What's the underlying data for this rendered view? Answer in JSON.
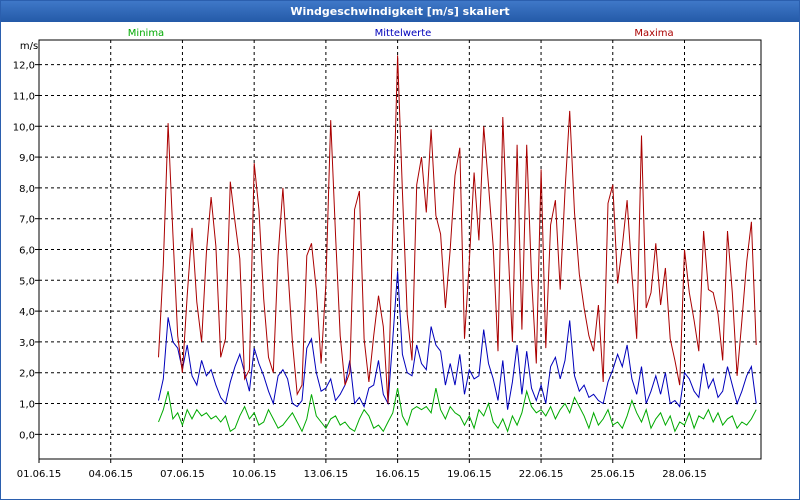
{
  "window": {
    "title": "Windgeschwindigkeit [m/s] skaliert"
  },
  "colors": {
    "minima": "#00aa00",
    "mittelwerte": "#0000bb",
    "maxima": "#aa0000",
    "grid": "#000000"
  },
  "chart_data": {
    "type": "line",
    "ylabel": "m/s",
    "ylim": [
      -0.8,
      12.8
    ],
    "xlim": [
      0,
      30.2
    ],
    "x_ticks": [
      0,
      3,
      6,
      9,
      12,
      15,
      18,
      21,
      24,
      27
    ],
    "x_tick_labels": [
      "01.06.15",
      "04.06.15",
      "07.06.15",
      "10.06.15",
      "13.06.15",
      "16.06.15",
      "19.06.15",
      "22.06.15",
      "25.06.15",
      "28.06.15"
    ],
    "y_ticks": [
      0,
      1,
      2,
      3,
      4,
      5,
      6,
      7,
      8,
      9,
      10,
      11,
      12
    ],
    "y_tick_labels": [
      "0,0",
      "1,0",
      "2,0",
      "3,0",
      "4,0",
      "5,0",
      "6,0",
      "7,0",
      "8,0",
      "9,0",
      "10,0",
      "11,0",
      "12,0"
    ],
    "grid": true,
    "legend_position": "top",
    "x": [
      5.0,
      5.2,
      5.4,
      5.6,
      5.8,
      6.0,
      6.2,
      6.4,
      6.6,
      6.8,
      7.0,
      7.2,
      7.4,
      7.6,
      7.8,
      8.0,
      8.2,
      8.4,
      8.6,
      8.8,
      9.0,
      9.2,
      9.4,
      9.6,
      9.8,
      10.0,
      10.2,
      10.4,
      10.6,
      10.8,
      11.0,
      11.2,
      11.4,
      11.6,
      11.8,
      12.0,
      12.2,
      12.4,
      12.6,
      12.8,
      13.0,
      13.2,
      13.4,
      13.6,
      13.8,
      14.0,
      14.2,
      14.4,
      14.6,
      14.8,
      15.0,
      15.2,
      15.4,
      15.6,
      15.8,
      16.0,
      16.2,
      16.4,
      16.6,
      16.8,
      17.0,
      17.2,
      17.4,
      17.6,
      17.8,
      18.0,
      18.2,
      18.4,
      18.6,
      18.8,
      19.0,
      19.2,
      19.4,
      19.6,
      19.8,
      20.0,
      20.2,
      20.4,
      20.6,
      20.8,
      21.0,
      21.2,
      21.4,
      21.6,
      21.8,
      22.0,
      22.2,
      22.4,
      22.6,
      22.8,
      23.0,
      23.2,
      23.4,
      23.6,
      23.8,
      24.0,
      24.2,
      24.4,
      24.6,
      24.8,
      25.0,
      25.2,
      25.4,
      25.6,
      25.8,
      26.0,
      26.2,
      26.4,
      26.6,
      26.8,
      27.0,
      27.2,
      27.4,
      27.6,
      27.8,
      28.0,
      28.2,
      28.4,
      28.6,
      28.8,
      29.0,
      29.2,
      29.4,
      29.6,
      29.8,
      30.0
    ],
    "series": [
      {
        "name": "Minima",
        "color": "#00aa00",
        "values": [
          0.4,
          0.8,
          1.4,
          0.5,
          0.7,
          0.3,
          0.8,
          0.5,
          0.8,
          0.6,
          0.7,
          0.5,
          0.6,
          0.4,
          0.6,
          0.1,
          0.2,
          0.6,
          0.9,
          0.5,
          0.7,
          0.3,
          0.4,
          0.8,
          0.5,
          0.2,
          0.3,
          0.5,
          0.7,
          0.4,
          0.1,
          0.5,
          1.3,
          0.6,
          0.4,
          0.2,
          0.5,
          0.6,
          0.3,
          0.4,
          0.2,
          0.1,
          0.5,
          0.8,
          0.6,
          0.2,
          0.3,
          0.1,
          0.4,
          0.7,
          1.5,
          0.6,
          0.3,
          0.8,
          0.9,
          0.8,
          0.9,
          0.7,
          1.5,
          0.8,
          0.5,
          0.9,
          0.7,
          0.6,
          0.3,
          0.6,
          0.2,
          0.8,
          0.6,
          1.0,
          0.4,
          0.2,
          0.5,
          0.1,
          0.6,
          0.3,
          0.7,
          1.4,
          0.9,
          0.7,
          0.8,
          0.6,
          0.9,
          0.5,
          0.8,
          1.0,
          0.7,
          1.2,
          0.9,
          0.6,
          0.2,
          0.7,
          0.3,
          0.5,
          0.8,
          0.3,
          0.4,
          0.2,
          0.6,
          1.1,
          0.7,
          0.4,
          0.8,
          0.2,
          0.5,
          0.7,
          0.3,
          0.6,
          0.1,
          0.4,
          0.3,
          0.7,
          0.2,
          0.6,
          0.5,
          0.8,
          0.4,
          0.7,
          0.3,
          0.5,
          0.6,
          0.2,
          0.4,
          0.3,
          0.5,
          0.8
        ]
      },
      {
        "name": "Mittelwerte",
        "color": "#0000bb",
        "values": [
          1.1,
          1.8,
          3.8,
          3.0,
          2.8,
          2.1,
          2.9,
          1.9,
          1.6,
          2.4,
          1.9,
          2.1,
          1.6,
          1.2,
          1.0,
          1.7,
          2.2,
          2.6,
          2.0,
          1.4,
          2.8,
          2.3,
          1.9,
          1.4,
          1.0,
          1.9,
          2.1,
          1.8,
          1.0,
          0.9,
          1.1,
          2.8,
          3.1,
          2.0,
          1.4,
          1.5,
          1.8,
          1.1,
          1.3,
          1.6,
          2.4,
          1.0,
          1.2,
          0.9,
          1.5,
          1.6,
          2.4,
          1.3,
          1.0,
          3.1,
          5.3,
          2.6,
          2.0,
          1.9,
          2.9,
          2.3,
          2.1,
          3.5,
          2.9,
          2.7,
          1.6,
          2.3,
          1.6,
          2.6,
          1.3,
          2.1,
          1.8,
          1.9,
          3.4,
          2.3,
          1.8,
          1.1,
          2.4,
          0.8,
          1.7,
          2.9,
          1.3,
          2.7,
          1.5,
          1.1,
          1.6,
          1.0,
          2.2,
          2.5,
          1.8,
          2.4,
          3.7,
          1.9,
          1.4,
          1.6,
          1.2,
          1.3,
          1.1,
          1.0,
          1.7,
          2.1,
          2.6,
          2.2,
          2.9,
          1.8,
          1.3,
          2.2,
          1.0,
          1.4,
          1.9,
          1.3,
          2.0,
          1.0,
          1.1,
          0.9,
          2.0,
          1.8,
          1.4,
          1.2,
          2.3,
          1.5,
          1.8,
          1.2,
          1.4,
          2.2,
          1.6,
          1.0,
          1.4,
          1.9,
          2.2,
          1.0
        ]
      },
      {
        "name": "Maxima",
        "color": "#aa0000",
        "values": [
          2.5,
          5.5,
          10.1,
          6.5,
          3.2,
          2.0,
          4.5,
          6.7,
          4.3,
          3.0,
          5.9,
          7.7,
          6.1,
          2.5,
          3.1,
          8.2,
          6.9,
          5.7,
          1.8,
          2.1,
          8.8,
          7.3,
          4.4,
          2.5,
          2.0,
          5.8,
          8.0,
          5.5,
          3.0,
          1.3,
          1.6,
          5.8,
          6.2,
          4.7,
          2.3,
          4.9,
          10.2,
          6.5,
          3.2,
          1.6,
          2.0,
          7.3,
          7.9,
          3.1,
          1.7,
          3.2,
          4.5,
          3.5,
          1.0,
          6.7,
          12.3,
          7.9,
          3.9,
          2.4,
          8.1,
          9.0,
          7.2,
          9.9,
          7.1,
          6.5,
          4.1,
          6.0,
          8.4,
          9.3,
          3.1,
          5.6,
          8.5,
          6.3,
          10.0,
          8.1,
          6.1,
          2.7,
          10.3,
          6.4,
          3.0,
          9.4,
          3.4,
          9.4,
          5.1,
          2.3,
          8.6,
          2.8,
          6.8,
          7.6,
          4.7,
          7.9,
          10.5,
          7.2,
          5.2,
          4.1,
          3.2,
          2.7,
          4.2,
          1.7,
          7.5,
          8.1,
          4.9,
          6.1,
          7.6,
          5.2,
          3.1,
          9.7,
          4.1,
          4.6,
          6.2,
          4.2,
          5.4,
          3.1,
          2.4,
          1.6,
          6.0,
          4.6,
          3.7,
          2.7,
          6.6,
          4.7,
          4.6,
          3.9,
          2.4,
          6.6,
          4.6,
          1.9,
          3.7,
          5.6,
          6.9,
          2.9
        ]
      }
    ]
  }
}
